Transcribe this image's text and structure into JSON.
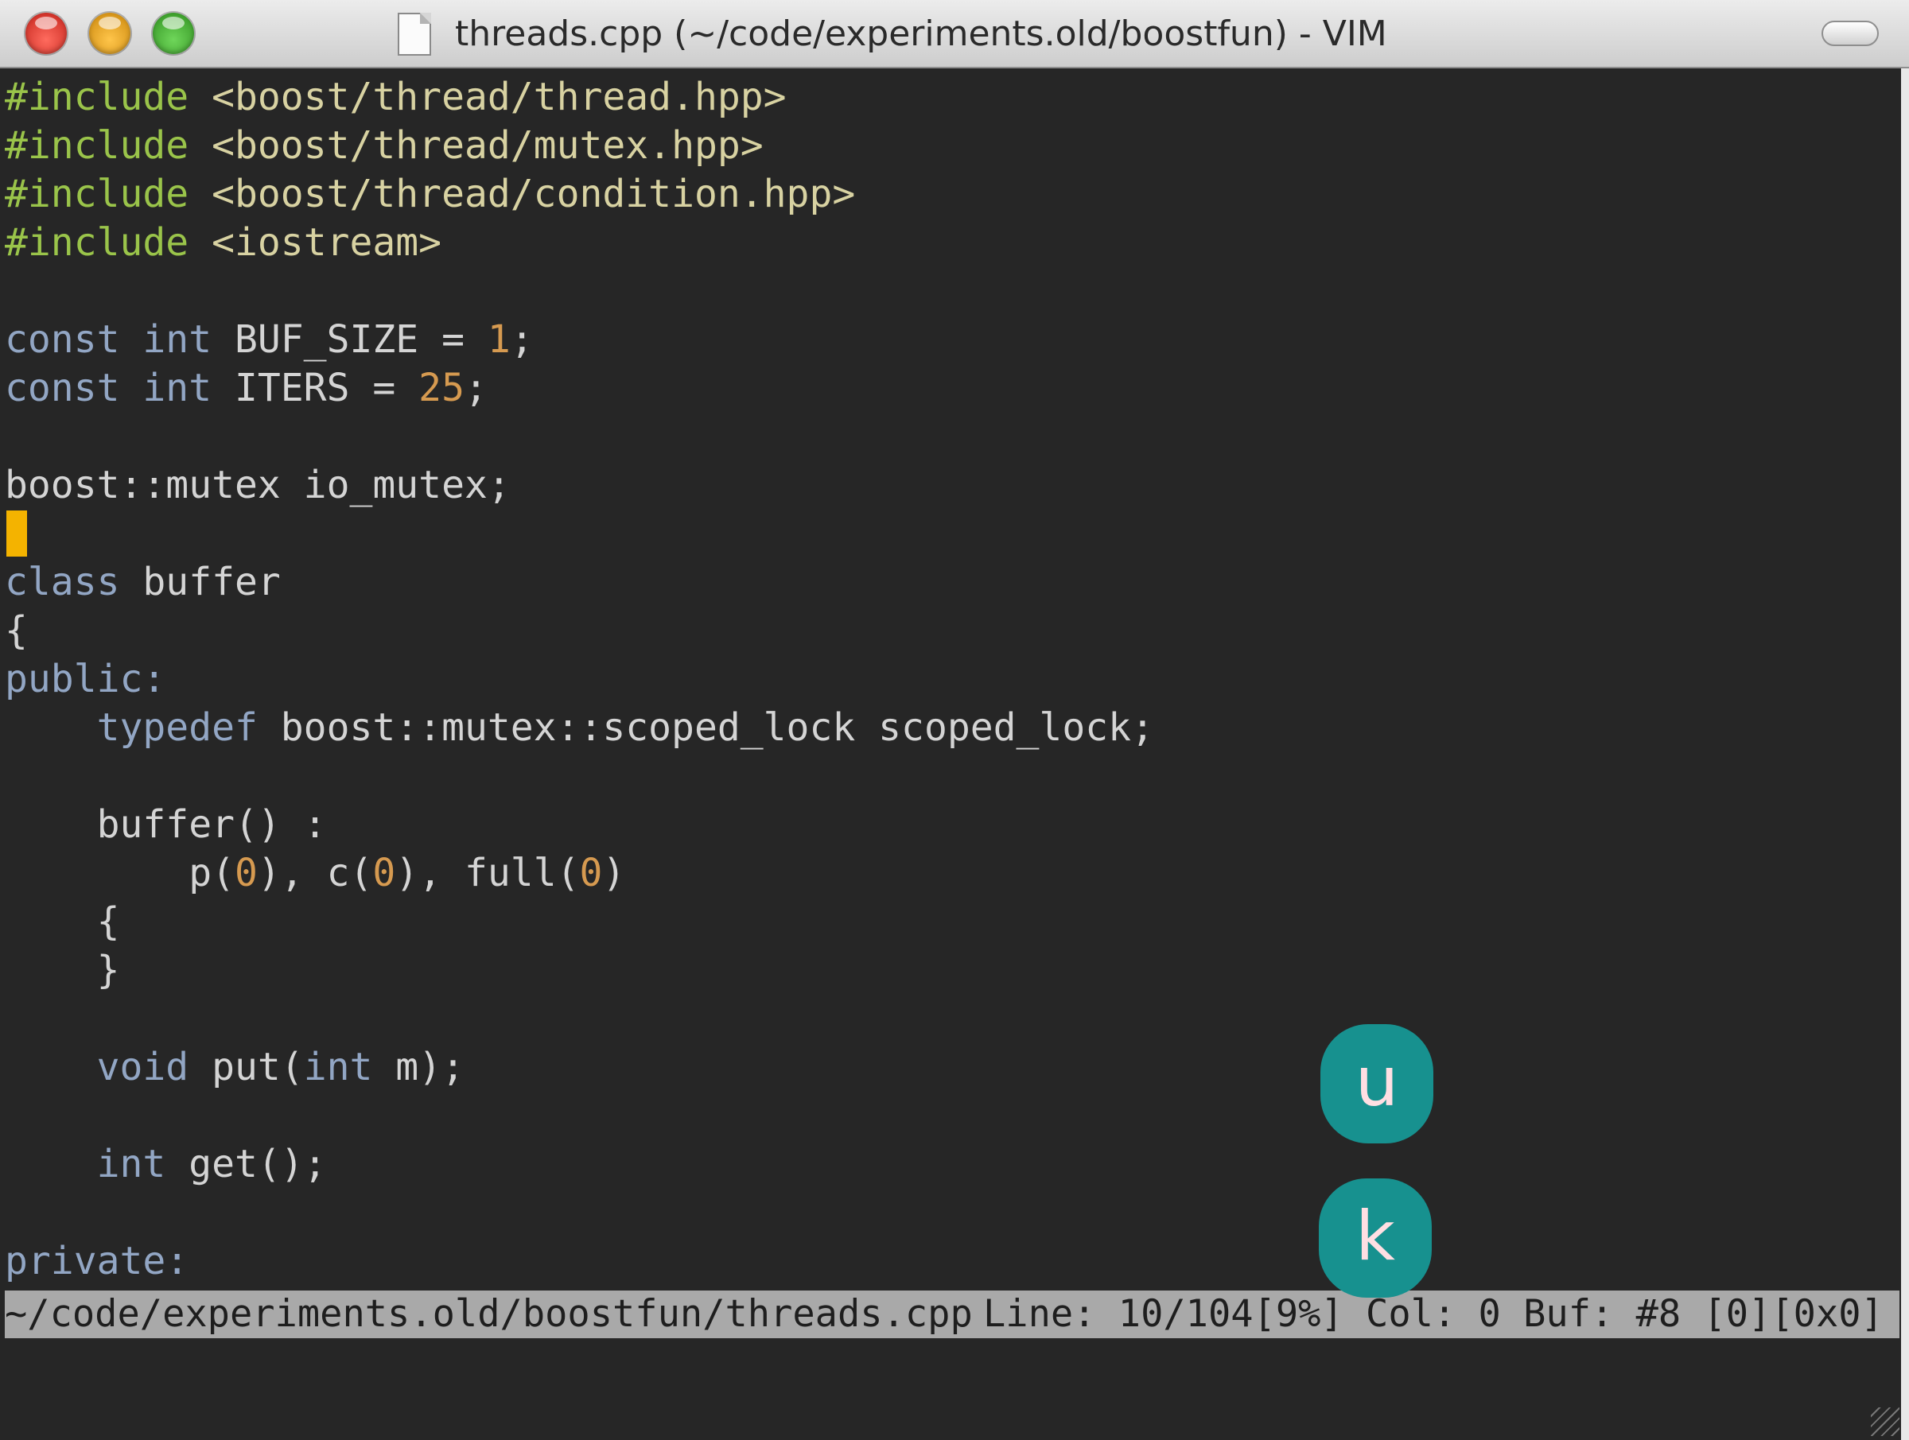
{
  "window": {
    "title": "threads.cpp (~/code/experiments.old/boostfun) - VIM"
  },
  "editor": {
    "lines": [
      [
        {
          "t": "#include ",
          "c": "pre"
        },
        {
          "t": "<boost/thread/thread.hpp>",
          "c": "str"
        }
      ],
      [
        {
          "t": "#include ",
          "c": "pre"
        },
        {
          "t": "<boost/thread/mutex.hpp>",
          "c": "str"
        }
      ],
      [
        {
          "t": "#include ",
          "c": "pre"
        },
        {
          "t": "<boost/thread/condition.hpp>",
          "c": "str"
        }
      ],
      [
        {
          "t": "#include ",
          "c": "pre"
        },
        {
          "t": "<iostream>",
          "c": "str"
        }
      ],
      [],
      [
        {
          "t": "const int ",
          "c": "type"
        },
        {
          "t": "BUF_SIZE = ",
          "c": "plain"
        },
        {
          "t": "1",
          "c": "num"
        },
        {
          "t": ";",
          "c": "plain"
        }
      ],
      [
        {
          "t": "const int ",
          "c": "type"
        },
        {
          "t": "ITERS = ",
          "c": "plain"
        },
        {
          "t": "25",
          "c": "num"
        },
        {
          "t": ";",
          "c": "plain"
        }
      ],
      [],
      [
        {
          "t": "boost::mutex io_mutex;",
          "c": "plain"
        }
      ],
      [],
      [
        {
          "t": "class ",
          "c": "type"
        },
        {
          "t": "buffer",
          "c": "plain"
        }
      ],
      [
        {
          "t": "{",
          "c": "plain"
        }
      ],
      [
        {
          "t": "public:",
          "c": "type"
        }
      ],
      [
        {
          "t": "    ",
          "c": "plain"
        },
        {
          "t": "typedef ",
          "c": "type"
        },
        {
          "t": "boost::mutex::scoped_lock scoped_lock;",
          "c": "plain"
        }
      ],
      [],
      [
        {
          "t": "    buffer() :",
          "c": "plain"
        }
      ],
      [
        {
          "t": "        p(",
          "c": "plain"
        },
        {
          "t": "0",
          "c": "num"
        },
        {
          "t": "), c(",
          "c": "plain"
        },
        {
          "t": "0",
          "c": "num"
        },
        {
          "t": "), full(",
          "c": "plain"
        },
        {
          "t": "0",
          "c": "num"
        },
        {
          "t": ")",
          "c": "plain"
        }
      ],
      [
        {
          "t": "    {",
          "c": "plain"
        }
      ],
      [
        {
          "t": "    }",
          "c": "plain"
        }
      ],
      [],
      [
        {
          "t": "    ",
          "c": "plain"
        },
        {
          "t": "void ",
          "c": "type"
        },
        {
          "t": "put(",
          "c": "plain"
        },
        {
          "t": "int ",
          "c": "type"
        },
        {
          "t": "m);",
          "c": "plain"
        }
      ],
      [],
      [
        {
          "t": "    ",
          "c": "plain"
        },
        {
          "t": "int ",
          "c": "type"
        },
        {
          "t": "get();",
          "c": "plain"
        }
      ],
      [],
      [
        {
          "t": "private:",
          "c": "type"
        }
      ]
    ]
  },
  "status": {
    "file": "~/code/experiments.old/boostfun/threads.cpp",
    "info": "Line: 10/104[9%] Col: 0 Buf: #8 [0][0x0]"
  },
  "keystrokes": [
    "u",
    "k"
  ],
  "colors": {
    "preprocessor": "#9ac44a",
    "string": "#d8d2a2",
    "keyword": "#92a6c4",
    "number": "#d69a50",
    "cursor": "#f4b300",
    "key_bubble": "#17918f"
  }
}
